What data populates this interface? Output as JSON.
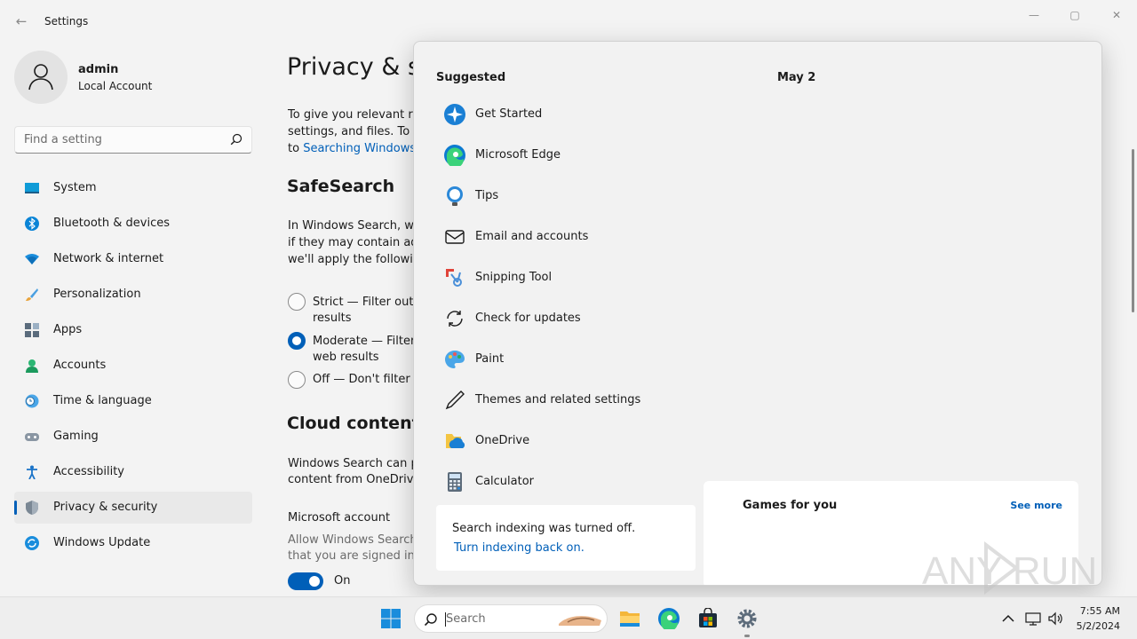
{
  "window": {
    "title": "Settings",
    "controls": {
      "minimize": "—",
      "maximize": "▢",
      "close": "✕"
    }
  },
  "profile": {
    "name": "admin",
    "account_type": "Local Account"
  },
  "search_setting": {
    "placeholder": "Find a setting"
  },
  "nav": {
    "items": [
      {
        "label": "System",
        "icon": "system-icon"
      },
      {
        "label": "Bluetooth & devices",
        "icon": "bluetooth-icon"
      },
      {
        "label": "Network & internet",
        "icon": "wifi-icon"
      },
      {
        "label": "Personalization",
        "icon": "brush-icon"
      },
      {
        "label": "Apps",
        "icon": "apps-icon"
      },
      {
        "label": "Accounts",
        "icon": "accounts-icon"
      },
      {
        "label": "Time & language",
        "icon": "clock-globe-icon"
      },
      {
        "label": "Gaming",
        "icon": "gamepad-icon"
      },
      {
        "label": "Accessibility",
        "icon": "accessibility-icon"
      },
      {
        "label": "Privacy & security",
        "icon": "shield-icon",
        "active": true
      },
      {
        "label": "Windows Update",
        "icon": "update-icon"
      }
    ]
  },
  "page": {
    "title": "Privacy & se",
    "intro": {
      "line1": "To give you relevant res",
      "line2": "settings, and files. To ch",
      "line3_prefix": "to ",
      "line3_link": "Searching Windows"
    },
    "safesearch": {
      "title": "SafeSearch",
      "desc1": "In Windows Search, we",
      "desc2": "if they may contain adu",
      "desc3": "we'll apply the followin",
      "options": [
        {
          "line1": "Strict — Filter out a",
          "line2": "results",
          "checked": false
        },
        {
          "line1": "Moderate — Filter",
          "line2": "web results",
          "checked": true
        },
        {
          "line1": "Off — Don't filter a",
          "checked": false
        }
      ]
    },
    "cloud": {
      "title": "Cloud content s",
      "desc1": "Windows Search can pe",
      "desc2": "content from OneDrive",
      "ms_account_label": "Microsoft account",
      "ms_desc1": "Allow Windows Search",
      "ms_desc2": "that you are signed in t",
      "toggle_state": "On"
    }
  },
  "flyout": {
    "suggested_heading": "Suggested",
    "date_heading": "May 2",
    "suggestions": [
      {
        "label": "Get Started",
        "icon": "get-started-icon"
      },
      {
        "label": "Microsoft Edge",
        "icon": "edge-icon"
      },
      {
        "label": "Tips",
        "icon": "tips-icon"
      },
      {
        "label": "Email and accounts",
        "icon": "mail-icon"
      },
      {
        "label": "Snipping Tool",
        "icon": "snipping-tool-icon"
      },
      {
        "label": "Check for updates",
        "icon": "refresh-icon"
      },
      {
        "label": "Paint",
        "icon": "paint-icon"
      },
      {
        "label": "Themes and related settings",
        "icon": "pen-icon"
      },
      {
        "label": "OneDrive",
        "icon": "onedrive-icon"
      },
      {
        "label": "Calculator",
        "icon": "calculator-icon"
      }
    ],
    "indexing": {
      "message": "Search indexing was turned off.",
      "link": "Turn indexing back on."
    },
    "games": {
      "title": "Games for you",
      "see_more": "See more"
    }
  },
  "watermark": {
    "text": "ANY RUN"
  },
  "taskbar": {
    "search_placeholder": "Search",
    "apps": [
      "windows-start-icon",
      "file-explorer-icon",
      "edge-icon",
      "store-icon",
      "settings-gear-icon"
    ],
    "clock": {
      "time": "7:55 AM",
      "date": "5/2/2024"
    }
  },
  "colors": {
    "accent": "#005fb8",
    "background": "#f3f3f3",
    "flyout": "#f2f2f2"
  }
}
